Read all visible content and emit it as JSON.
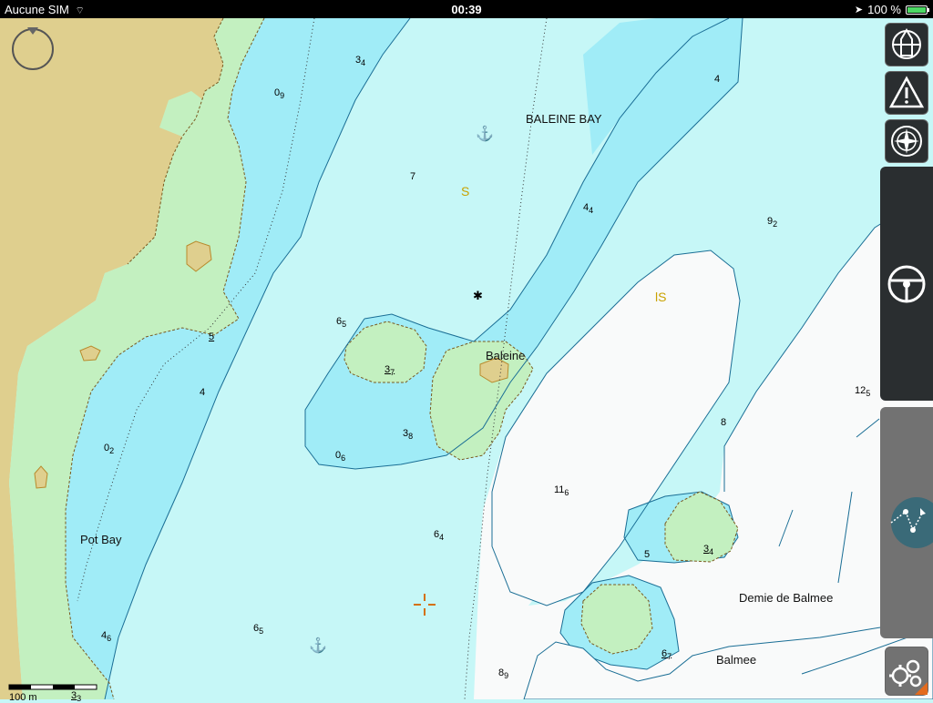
{
  "status": {
    "carrier": "Aucune SIM",
    "time": "00:39",
    "battery": "100 %",
    "battery_level": 1.0
  },
  "map": {
    "places": {
      "baleine_bay": "BALEINE BAY",
      "baleine": "Baleine",
      "pot_bay": "Pot Bay",
      "demie_de_balmee": "Demie de Balmee",
      "balmee": "Balmee"
    },
    "seabed": {
      "s1": "S",
      "s2": "lS"
    },
    "soundings": [
      {
        "main": "3",
        "sub": "4"
      },
      {
        "main": "0",
        "sub": "9"
      },
      {
        "main": "7",
        "sub": ""
      },
      {
        "main": "4",
        "sub": "4"
      },
      {
        "main": "4",
        "sub": ""
      },
      {
        "main": "9",
        "sub": "2"
      },
      {
        "main": "6",
        "sub": "5"
      },
      {
        "main": "5",
        "sub": ""
      },
      {
        "main": "3",
        "sub": "7"
      },
      {
        "main": "4",
        "sub": ""
      },
      {
        "main": "0",
        "sub": "2"
      },
      {
        "main": "3",
        "sub": "8"
      },
      {
        "main": "0",
        "sub": "6"
      },
      {
        "main": "12",
        "sub": "5"
      },
      {
        "main": "8",
        "sub": ""
      },
      {
        "main": "11",
        "sub": "6"
      },
      {
        "main": "6",
        "sub": "4"
      },
      {
        "main": "5",
        "sub": ""
      },
      {
        "main": "3",
        "sub": "4"
      },
      {
        "main": "6",
        "sub": "5"
      },
      {
        "main": "4",
        "sub": "6"
      },
      {
        "main": "6",
        "sub": "7"
      },
      {
        "main": "8",
        "sub": "9"
      },
      {
        "main": "3",
        "sub": "3"
      }
    ],
    "scale_label": "100 m"
  },
  "toolbar": {
    "icons": [
      "boat-icon",
      "warning-icon",
      "compass-icon",
      "helm-icon",
      "route-icon",
      "settings-icon"
    ]
  },
  "colors": {
    "land": "#dfcf8e",
    "intertidal": "#c3f0c0",
    "shallow": "#a0ecf7",
    "medium": "#c6f7f7",
    "deep": "#f9fafa",
    "contour": "#1a6e95"
  }
}
